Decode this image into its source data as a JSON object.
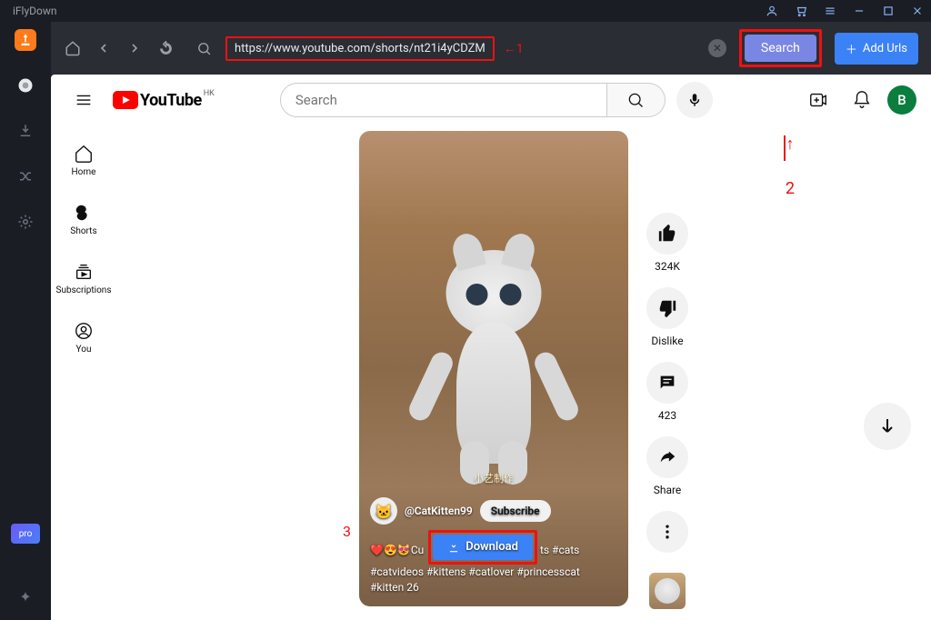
{
  "app": {
    "title": "iFlyDown"
  },
  "titlebar_icons": {
    "account": "account-icon",
    "cart": "cart-icon",
    "menu": "menu-icon",
    "min": "minimize-icon",
    "max": "maximize-icon",
    "close": "close-icon"
  },
  "leftbar": {
    "pro_label": "pro"
  },
  "toolbar": {
    "url": "https://www.youtube.com/shorts/nt21i4yCDZM",
    "search_label": "Search",
    "add_urls_label": "Add Urls"
  },
  "annotations": {
    "one": "1",
    "two": "2",
    "three": "3",
    "arrow_left": "←",
    "arrow_up": "↑"
  },
  "youtube": {
    "logo_text": "YouTube",
    "logo_region": "HK",
    "search_placeholder": "Search",
    "avatar_letter": "B",
    "side": {
      "home": "Home",
      "shorts": "Shorts",
      "subs": "Subscriptions",
      "you": "You"
    },
    "video": {
      "watermark": "小艺制作",
      "handle": "@CatKitten99",
      "subscribe": "Subscribe",
      "emoji_line": "❤️😍😻Cu",
      "caption_tail": "ts #cats",
      "caption_line2": "#catvideos #kittens #catlover #princesscat",
      "caption_line3": "#kitten 26",
      "download_label": "Download"
    },
    "actions": {
      "likes": "324K",
      "dislike": "Dislike",
      "comments": "423",
      "share": "Share"
    }
  }
}
